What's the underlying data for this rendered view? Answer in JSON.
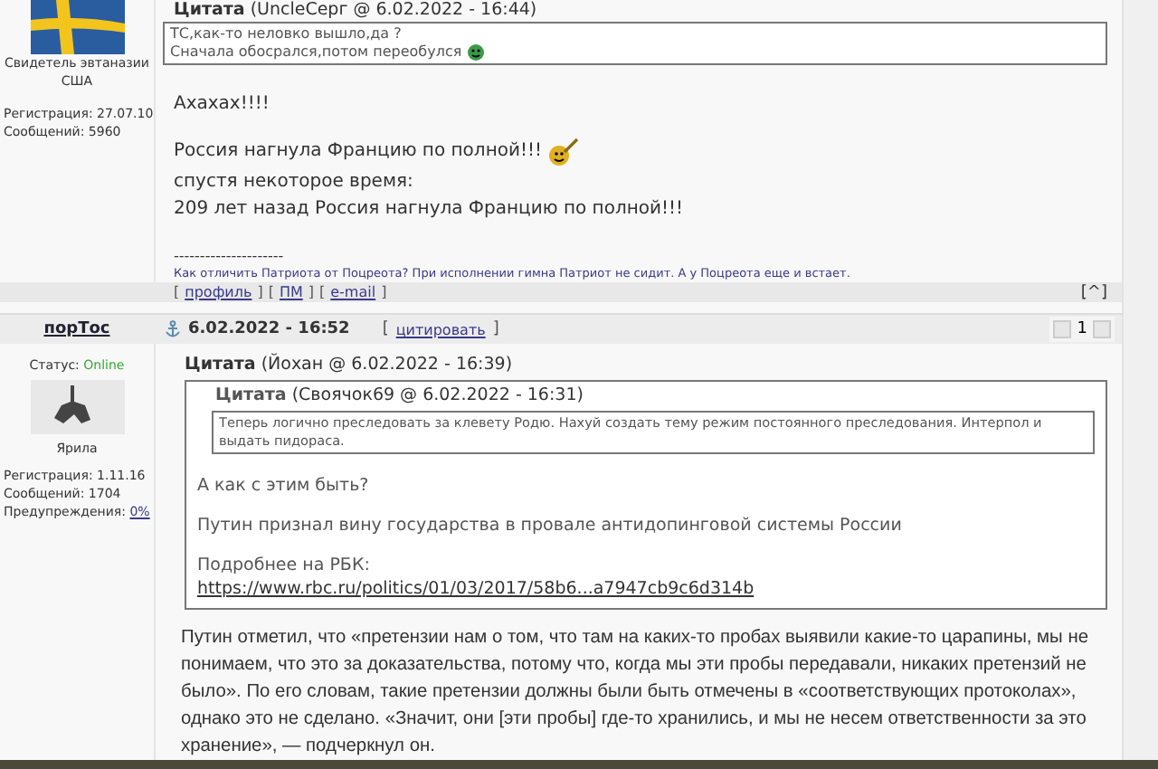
{
  "post_1": {
    "user": {
      "title": "Свидетель эвтаназии США",
      "registration": "Регистрация: 27.07.10",
      "messages": "Сообщений: 5960"
    },
    "quote": {
      "label": "Цитата",
      "source": "(UncleСерг @ 6.02.2022 - 16:44)",
      "lines": [
        "ТС,как-то неловко вышло,да ?",
        "Сначала обосрался,потом переобулся"
      ]
    },
    "body": [
      "Ахахах!!!!",
      "Россия нагнула Францию по полной!!!",
      "спустя некоторое время:",
      "209 лет назад Россия нагнула Францию по полной!!!"
    ],
    "signature_rule": "---------------------",
    "signature": "Как отличить Патриота от Поцреота? При исполнении гимна Патриот не сидит. А у Поцреота еще и встает.",
    "brackets": [
      "[",
      "]"
    ],
    "links": [
      "профиль",
      "ПМ",
      "e-mail"
    ],
    "top_link": "[^]"
  },
  "post_2": {
    "user": {
      "name": "порТос",
      "status_label": "Статус:",
      "status": "Online",
      "rank": "Ярила",
      "registration": "Регистрация: 1.11.16",
      "messages": "Сообщений: 1704",
      "warnings_label": "Предупреждения:",
      "warnings": "0%"
    },
    "date": "6.02.2022 - 16:52",
    "quote_button": "цитировать",
    "page": "1",
    "quote": {
      "label": "Цитата",
      "source": "(Йохан @ 6.02.2022 - 16:39)",
      "inner_quote": {
        "label": "Цитата",
        "source": "(Своячок69 @ 6.02.2022 - 16:31)",
        "text": "Теперь логично преследовать за клевету Родю. Нахуй создать тему режим постоянного преследования. Интерпол и выдать пидораса."
      },
      "lines": [
        "А как с этим быть?",
        "Путин признал вину государства в провале антидопинговой системы России",
        "Подробнее на РБК:"
      ],
      "link": "https://www.rbc.ru/politics/01/03/2017/58b6...a7947cb9c6d314b"
    },
    "body": "Путин отметил, что «претензии нам о том, что там на каких-то пробах выявили какие-то царапины, мы не понимаем, что это за доказательства, потому что, когда мы эти пробы передавали, никаких претензий не было». По его словам, такие претензии должны были быть отмечены в «соответствующих протоколах», однако это не сделано. «Значит, они [эти пробы] где-то хранились, и мы не несем ответственности за это хранение», — подчеркнул он."
  }
}
